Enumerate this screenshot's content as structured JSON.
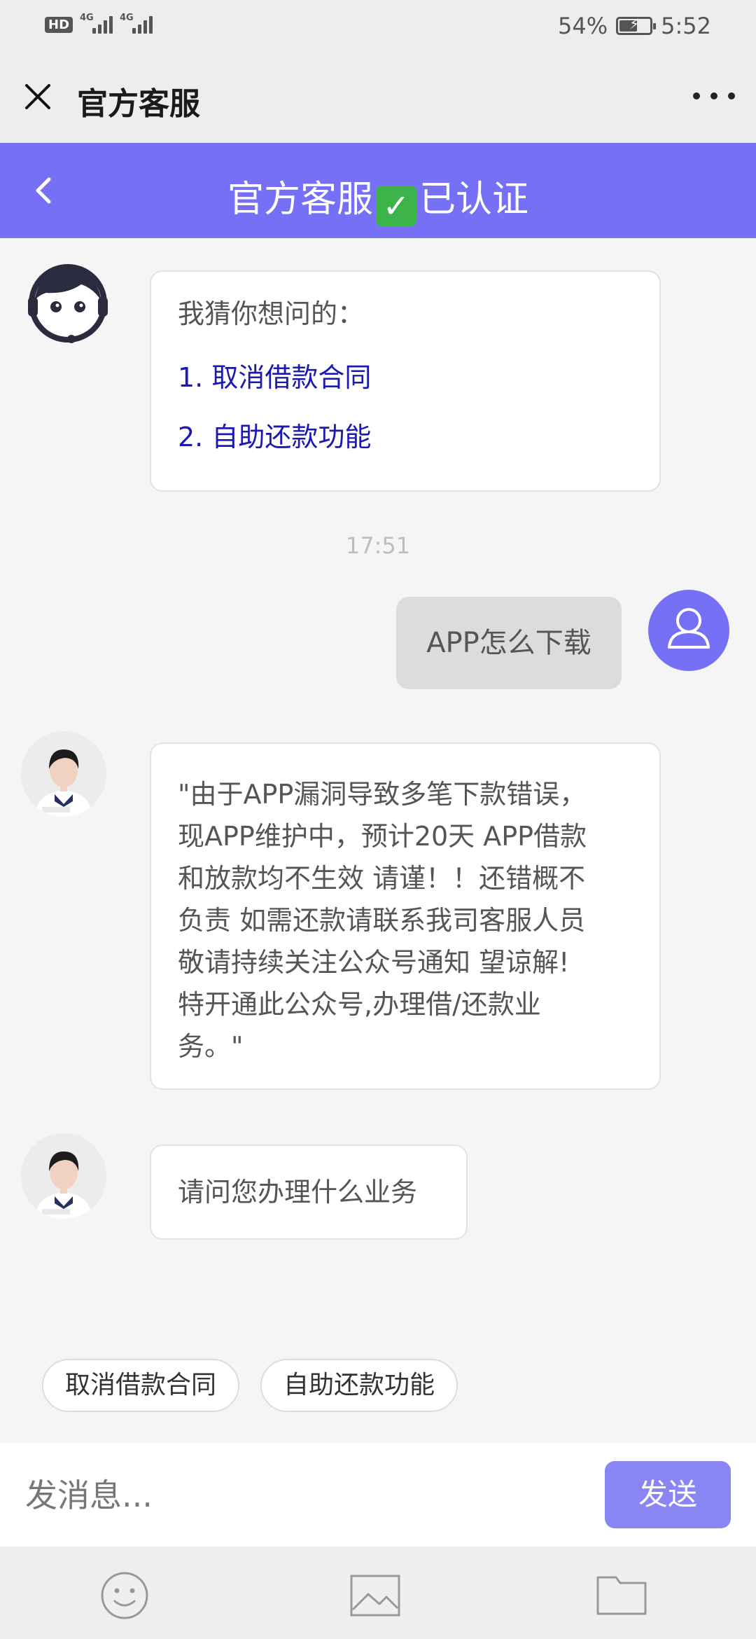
{
  "status_bar": {
    "hd": "HD",
    "network1": "4G",
    "network2": "4G",
    "battery_percent": "54%",
    "battery_level": 0.54,
    "time": "5:52"
  },
  "title_bar": {
    "title": "官方客服"
  },
  "chat_header": {
    "title_left": "官方客服",
    "check_glyph": "✓",
    "title_right": "已认证"
  },
  "messages": {
    "suggest": {
      "intro": "我猜你想问的：",
      "items": [
        "1.  取消借款合同",
        "2.  自助还款功能"
      ]
    },
    "timestamp": "17:51",
    "user_msg": "APP怎么下载",
    "notice_lines": [
      "\"由于APP漏洞导致多笔下款错误，",
      "现APP维护中，预计20天  APP借款",
      "和放款均不生效  请谨！！还错概不",
      "负责  如需还款请联系我司客服人员",
      "敬请持续关注公众号通知  望谅解!",
      "特开通此公众号,办理借/还款业",
      "务。\""
    ],
    "question": "请问您办理什么业务"
  },
  "quick_replies": [
    "取消借款合同",
    "自助还款功能"
  ],
  "input": {
    "placeholder": "发消息...",
    "send_label": "发送"
  },
  "toolbar": {
    "icons": [
      "emoji-icon",
      "image-icon",
      "folder-icon"
    ]
  },
  "colors": {
    "header": "#7570f5",
    "send": "#8a85f5",
    "link": "#1c19b0",
    "check": "#3cb44a"
  }
}
